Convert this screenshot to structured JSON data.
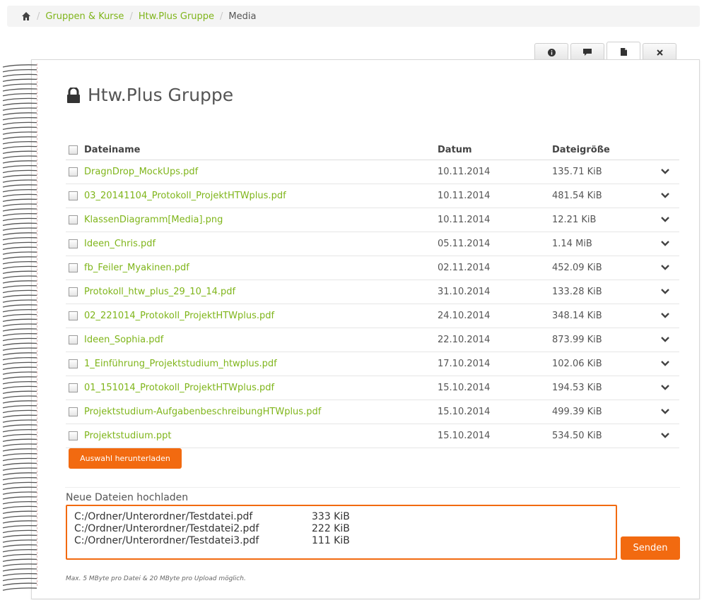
{
  "breadcrumb": {
    "home_icon": "home-icon",
    "items": [
      "Gruppen & Kurse",
      "Htw.Plus Gruppe"
    ],
    "current": "Media"
  },
  "tabs": [
    {
      "icon": "info-icon"
    },
    {
      "icon": "comment-icon"
    },
    {
      "icon": "file-icon",
      "active": true
    },
    {
      "icon": "close-icon"
    }
  ],
  "page": {
    "title": "Htw.Plus Gruppe",
    "title_icon": "lock-icon"
  },
  "table": {
    "headers": {
      "name": "Dateiname",
      "date": "Datum",
      "size": "Dateigröße"
    },
    "rows": [
      {
        "name": "DragnDrop_MockUps.pdf",
        "date": "10.11.2014",
        "size": "135.71 KiB"
      },
      {
        "name": "03_20141104_Protokoll_ProjektHTWplus.pdf",
        "date": "10.11.2014",
        "size": "481.54 KiB"
      },
      {
        "name": "KlassenDiagramm[Media].png",
        "date": "10.11.2014",
        "size": "12.21 KiB"
      },
      {
        "name": "Ideen_Chris.pdf",
        "date": "05.11.2014",
        "size": "1.14 MiB"
      },
      {
        "name": "fb_Feiler_Myakinen.pdf",
        "date": "02.11.2014",
        "size": "452.09 KiB"
      },
      {
        "name": "Protokoll_htw_plus_29_10_14.pdf",
        "date": "31.10.2014",
        "size": "133.28 KiB"
      },
      {
        "name": "02_221014_Protokoll_ProjektHTWplus.pdf",
        "date": "24.10.2014",
        "size": "348.14 KiB"
      },
      {
        "name": "Ideen_Sophia.pdf",
        "date": "22.10.2014",
        "size": "873.99 KiB"
      },
      {
        "name": "1_Einführung_Projektstudium_htwplus.pdf",
        "date": "17.10.2014",
        "size": "102.06 KiB"
      },
      {
        "name": "01_151014_Protokoll_ProjektHTWplus.pdf",
        "date": "15.10.2014",
        "size": "194.53 KiB"
      },
      {
        "name": "Projektstudium-AufgabenbeschreibungHTWplus.pdf",
        "date": "15.10.2014",
        "size": "499.39 KiB"
      },
      {
        "name": "Projektstudium.ppt",
        "date": "15.10.2014",
        "size": "534.50 KiB"
      }
    ]
  },
  "download_button": "Auswahl herunterladen",
  "upload": {
    "label": "Neue Dateien hochladen",
    "files": [
      {
        "path": "C:/Ordner/Unterordner/Testdatei.pdf",
        "size": "333 KiB"
      },
      {
        "path": "C:/Ordner/Unterordner/Testdatei2.pdf",
        "size": "222 KiB"
      },
      {
        "path": "C:/Ordner/Unterordner/Testdatei3.pdf",
        "size": "111 KiB"
      }
    ],
    "send_button": "Senden",
    "note": "Max. 5 MByte pro Datei & 20 MByte pro Upload möglich."
  },
  "colors": {
    "accent": "#f26a10",
    "link": "#7fb51a"
  }
}
